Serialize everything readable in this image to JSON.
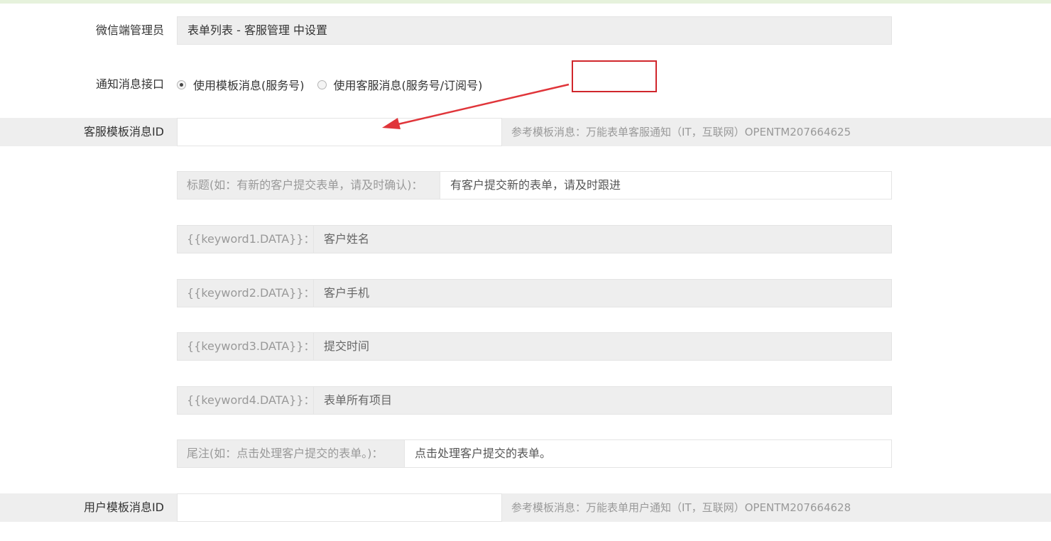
{
  "admin": {
    "label": "微信端管理员",
    "value": "表单列表 - 客服管理 中设置"
  },
  "notify": {
    "label": "通知消息接口",
    "options": [
      {
        "label": "使用模板消息(服务号)",
        "checked": true
      },
      {
        "label": "使用客服消息(服务号/订阅号)",
        "checked": false
      }
    ]
  },
  "service_template": {
    "label": "客服模板消息ID",
    "value": "",
    "hint": "参考模板消息：万能表单客服通知（IT，互联网）OPENTM207664625"
  },
  "fields": {
    "title": {
      "addon": "标题(如：有新的客户提交表单，请及时确认)：",
      "value": "有客户提交新的表单，请及时跟进"
    },
    "keyword1": {
      "addon": "{{keyword1.DATA}}：",
      "value": "客户姓名"
    },
    "keyword2": {
      "addon": "{{keyword2.DATA}}：",
      "value": "客户手机"
    },
    "keyword3": {
      "addon": "{{keyword3.DATA}}：",
      "value": "提交时间"
    },
    "keyword4": {
      "addon": "{{keyword4.DATA}}：",
      "value": "表单所有项目"
    },
    "remark": {
      "addon": "尾注(如：点击处理客户提交的表单。)：",
      "value": "点击处理客户提交的表单。"
    }
  },
  "user_template": {
    "label": "用户模板消息ID",
    "value": "",
    "hint": "参考模板消息：万能表单用户通知（IT，互联网）OPENTM207664628"
  },
  "colors": {
    "annotation_red": "#d0262c",
    "band_grey": "#eeeeee",
    "top_bar_green": "#e6f2dc"
  }
}
